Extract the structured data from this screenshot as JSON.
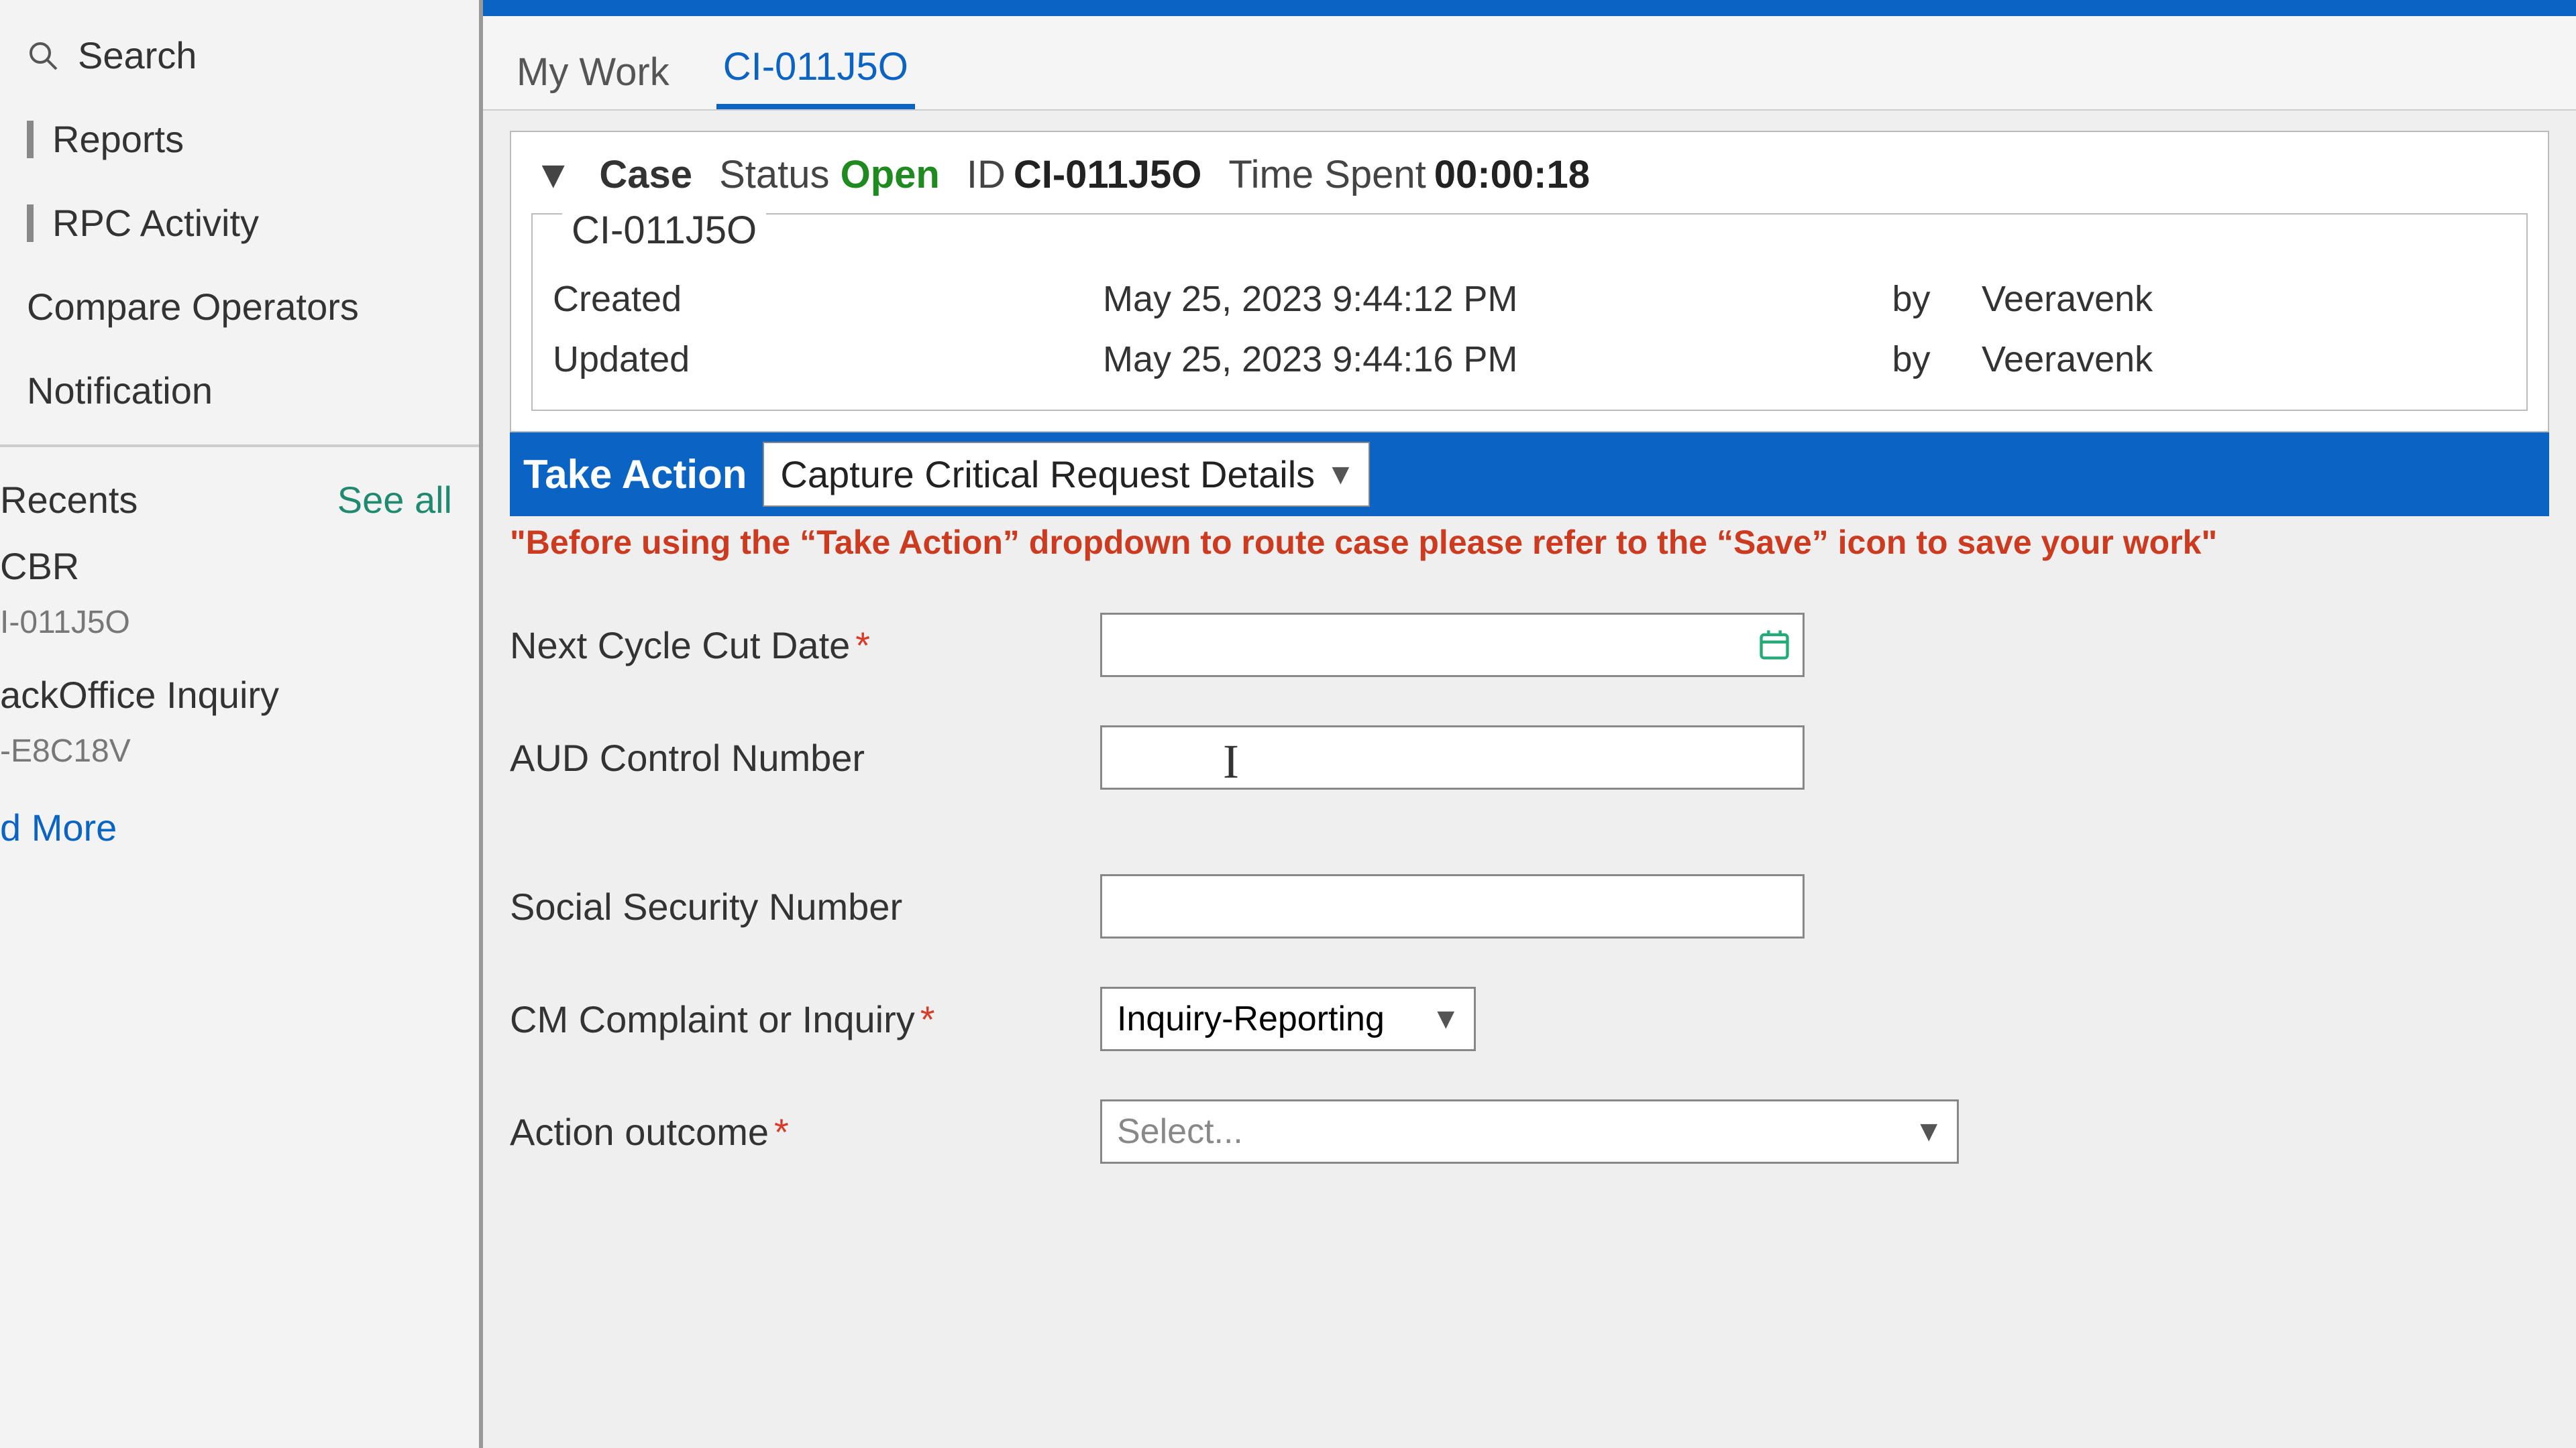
{
  "sidebar": {
    "search_label": "Search",
    "items": [
      "Reports",
      "RPC Activity",
      "Compare Operators",
      "Notification"
    ],
    "recents_label": "Recents",
    "see_all": "See all",
    "recents": [
      {
        "title": "CBR",
        "sub": "I-011J5O"
      },
      {
        "title": "ackOffice Inquiry",
        "sub": "-E8C18V"
      }
    ],
    "more_label": "d More"
  },
  "tabs": {
    "my_work": "My Work",
    "case_tab": "CI-011J5O"
  },
  "case": {
    "case_label": "Case",
    "status_label": "Status",
    "status_value": "Open",
    "id_label": "ID",
    "id_value": "CI-011J5O",
    "time_label": "Time Spent",
    "time_value": "00:00:18",
    "legend": "CI-011J5O",
    "created_label": "Created",
    "created_value": "May 25, 2023 9:44:12 PM",
    "updated_label": "Updated",
    "updated_value": "May 25, 2023 9:44:16 PM",
    "by_label": "by",
    "created_by": "Veeravenk",
    "updated_by": "Veeravenk"
  },
  "action": {
    "take_action_label": "Take Action",
    "selected": "Capture Critical Request Details",
    "warning": "\"Before using the “Take Action” dropdown to route case please refer to the “Save” icon to save your work\""
  },
  "form": {
    "next_cycle_label": "Next Cycle Cut Date",
    "aud_label": "AUD Control Number",
    "ssn_label": "Social Security Number",
    "cm_label": "CM Complaint or Inquiry",
    "cm_value": "Inquiry-Reporting",
    "outcome_label": "Action outcome",
    "outcome_value": "Select..."
  }
}
